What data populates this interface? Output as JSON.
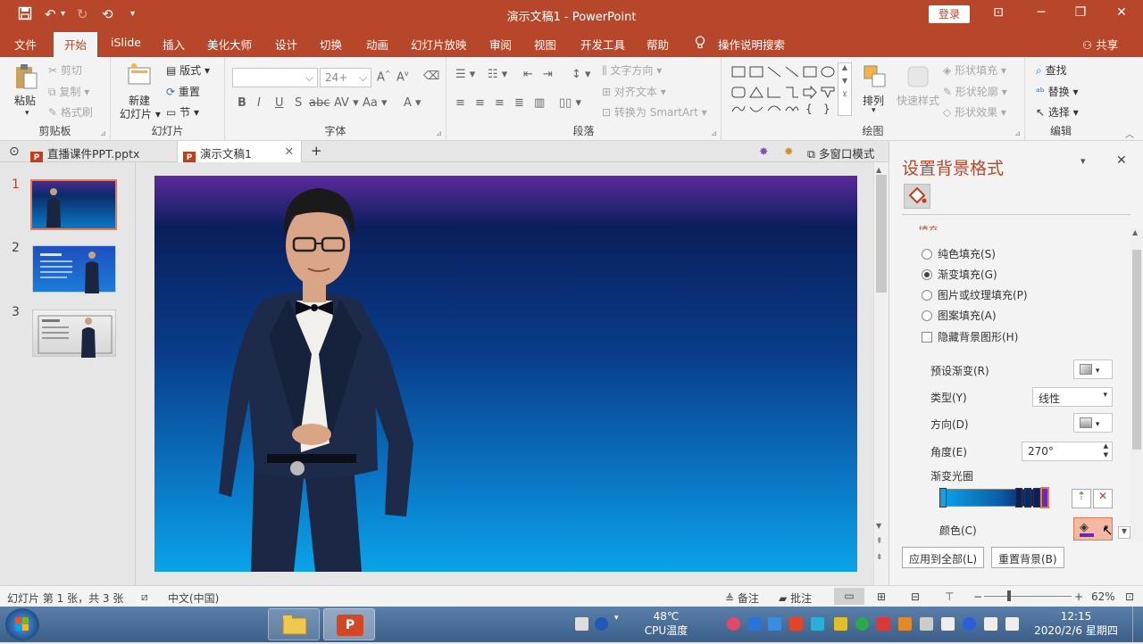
{
  "titlebar": {
    "doc_name": "演示文稿1",
    "separator": "-",
    "app_name": "PowerPoint",
    "login": "登录"
  },
  "menu": {
    "tabs": [
      "文件",
      "开始",
      "iSlide",
      "插入",
      "美化大师",
      "设计",
      "切换",
      "动画",
      "幻灯片放映",
      "审阅",
      "视图",
      "开发工具",
      "帮助"
    ],
    "search": "操作说明搜索",
    "share": "共享"
  },
  "ribbon": {
    "clipboard": {
      "paste": "粘贴",
      "cut": "剪切",
      "copy": "复制",
      "format_painter": "格式刷",
      "label": "剪贴板"
    },
    "slides": {
      "new_slide_1": "新建",
      "new_slide_2": "幻灯片",
      "layout": "版式",
      "reset": "重置",
      "section": "节",
      "label": "幻灯片"
    },
    "font": {
      "font_name": "",
      "font_size": "24+",
      "label": "字体"
    },
    "paragraph": {
      "text_direction": "文字方向",
      "align_text": "对齐文本",
      "smartart": "转换为 SmartArt",
      "label": "段落"
    },
    "drawing": {
      "arrange": "排列",
      "quick_styles": "快速样式",
      "shape_fill": "形状填充",
      "shape_outline": "形状轮廓",
      "shape_effects": "形状效果",
      "label": "绘图"
    },
    "editing": {
      "find": "查找",
      "replace": "替换",
      "select": "选择",
      "label": "编辑"
    }
  },
  "doctabs": {
    "tab1": "直播课件PPT.pptx",
    "tab2": "演示文稿1",
    "multiwindow": "多窗口模式"
  },
  "thumbnails": [
    "1",
    "2",
    "3"
  ],
  "pane": {
    "title": "设置背景格式",
    "section": "填充",
    "options": [
      "纯色填充(S)",
      "渐变填充(G)",
      "图片或纹理填充(P)",
      "图案填充(A)"
    ],
    "selected_option": 1,
    "hide_bg": "隐藏背景图形(H)",
    "preset_label": "预设渐变(R)",
    "type_label": "类型(Y)",
    "type_value": "线性",
    "direction_label": "方向(D)",
    "angle_label": "角度(E)",
    "angle_value": "270°",
    "stops_label": "渐变光圈",
    "color_label": "颜色(C)",
    "apply_all": "应用到全部(L)",
    "reset_bg": "重置背景(B)"
  },
  "status": {
    "slide_info": "幻灯片 第 1 张，共 3 张",
    "language": "中文(中国)",
    "notes": "备注",
    "comments": "批注",
    "zoom": "62%"
  },
  "taskbar": {
    "temp": "48℃",
    "cpu_label": "CPU温度",
    "time": "12:15",
    "date": "2020/2/6 星期四"
  },
  "colors": {
    "accent": "#b7472a",
    "slide_top": "#5b2a9b",
    "slide_bottom": "#0aa3e8"
  }
}
